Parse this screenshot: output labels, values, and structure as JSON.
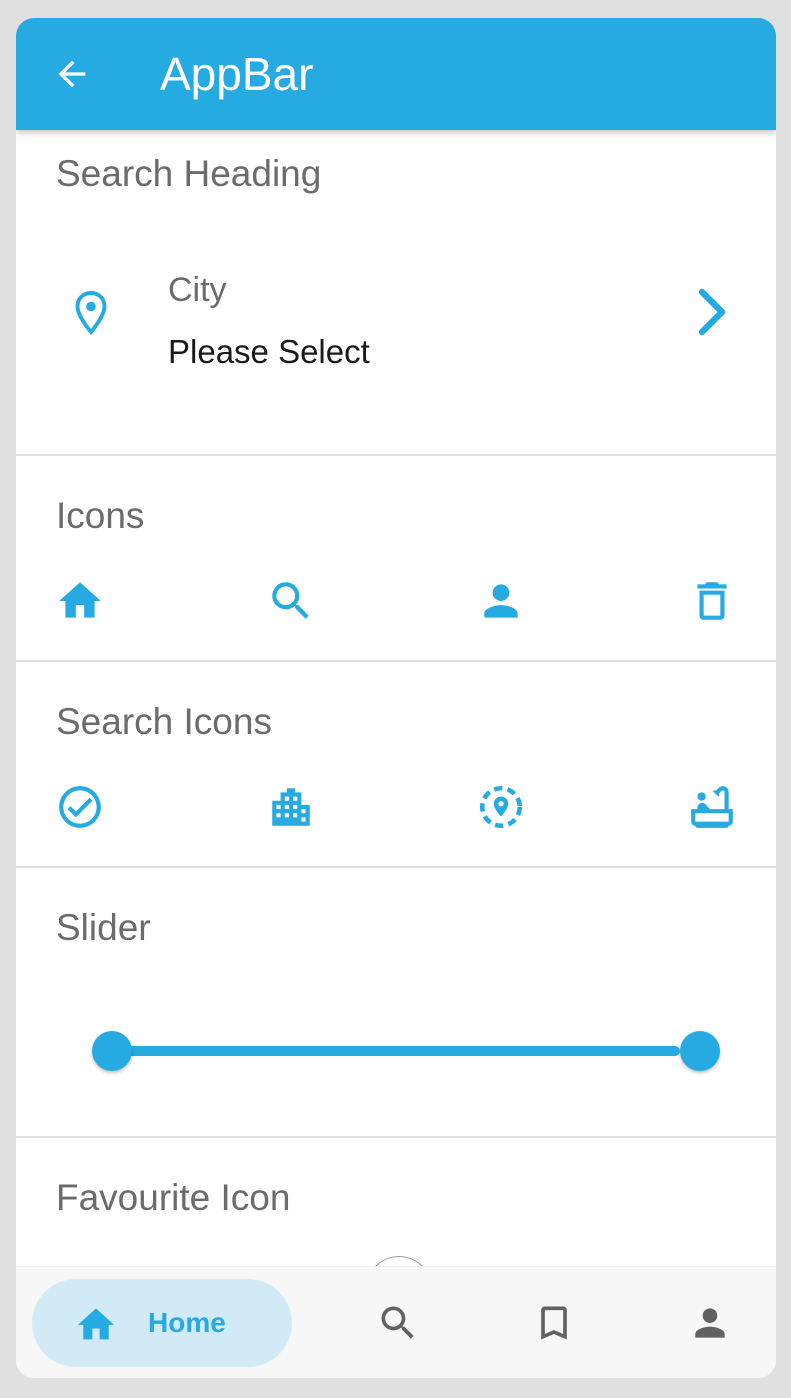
{
  "appbar": {
    "title": "AppBar",
    "back_icon": "arrow-back-icon"
  },
  "search_section": {
    "heading": "Search Heading",
    "city_label": "City",
    "city_value": "Please Select"
  },
  "icons_section": {
    "heading": "Icons",
    "icons": [
      "home-icon",
      "search-icon",
      "person-icon",
      "delete-icon"
    ]
  },
  "search_icons_section": {
    "heading": "Search Icons",
    "icons": [
      "check-circle-icon",
      "building-icon",
      "location-dashed-icon",
      "bathtub-icon"
    ]
  },
  "slider_section": {
    "heading": "Slider",
    "range_start": 0,
    "range_end": 1
  },
  "favourite_section": {
    "heading": "Favourite Icon"
  },
  "bottom_nav": {
    "items": [
      {
        "label": "Home",
        "icon": "home-icon",
        "active": true
      },
      {
        "label": "",
        "icon": "search-icon",
        "active": false
      },
      {
        "label": "",
        "icon": "bookmark-icon",
        "active": false
      },
      {
        "label": "",
        "icon": "person-icon",
        "active": false
      }
    ]
  },
  "colors": {
    "accent": "#25aae1",
    "background": "#e0e0e0",
    "surface": "#ffffff",
    "muted_text": "#6b6b6b",
    "nav_active_bg": "#d2eaf5",
    "nav_inactive_icon": "#616161"
  }
}
